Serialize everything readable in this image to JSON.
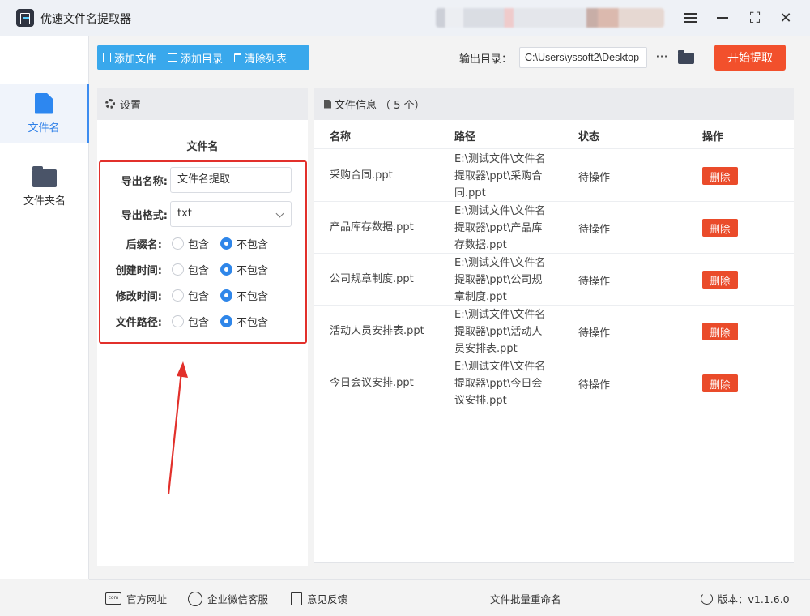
{
  "app": {
    "title": "优速文件名提取器"
  },
  "nav": {
    "items": [
      {
        "label": "文件名",
        "icon": "file-icon",
        "active": true
      },
      {
        "label": "文件夹名",
        "icon": "folder-icon",
        "active": false
      }
    ]
  },
  "toolbar": {
    "add_file": "添加文件",
    "add_dir": "添加目录",
    "clear_list": "清除列表",
    "output_label": "输出目录：",
    "output_path": "C:\\Users\\yssoft2\\Desktop",
    "more": "···",
    "start": "开始提取"
  },
  "settings": {
    "header": "设置",
    "section": "文件名",
    "export_name_label": "导出名称:",
    "export_name_value": "文件名提取",
    "export_format_label": "导出格式:",
    "export_format_value": "txt",
    "opt_include": "包含",
    "opt_exclude": "不包含",
    "rows": [
      {
        "label": "后缀名:",
        "selected": "不包含"
      },
      {
        "label": "创建时间:",
        "selected": "不包含"
      },
      {
        "label": "修改时间:",
        "selected": "不包含"
      },
      {
        "label": "文件路径:",
        "selected": "不包含"
      }
    ]
  },
  "files": {
    "header": "文件信息",
    "count": "（ 5 个）",
    "columns": {
      "name": "名称",
      "path": "路径",
      "status": "状态",
      "op": "操作"
    },
    "delete_label": "删除",
    "rows": [
      {
        "name": "采购合同.ppt",
        "path": "E:\\测试文件\\文件名提取器\\ppt\\采购合同.ppt",
        "status": "待操作"
      },
      {
        "name": "产品库存数据.ppt",
        "path": "E:\\测试文件\\文件名提取器\\ppt\\产品库存数据.ppt",
        "status": "待操作"
      },
      {
        "name": "公司规章制度.ppt",
        "path": "E:\\测试文件\\文件名提取器\\ppt\\公司规章制度.ppt",
        "status": "待操作"
      },
      {
        "name": "活动人员安排表.ppt",
        "path": "E:\\测试文件\\文件名提取器\\ppt\\活动人员安排表.ppt",
        "status": "待操作"
      },
      {
        "name": "今日会议安排.ppt",
        "path": "E:\\测试文件\\文件名提取器\\ppt\\今日会议安排.ppt",
        "status": "待操作"
      }
    ]
  },
  "footer": {
    "website": "官方网址",
    "wechat": "企业微信客服",
    "feedback": "意见反馈",
    "batch_rename": "文件批量重命名",
    "version": "版本：v1.1.6.0"
  },
  "colors": {
    "accent": "#39a8ec",
    "danger": "#f2502c",
    "highlight_box": "#e2302b"
  }
}
